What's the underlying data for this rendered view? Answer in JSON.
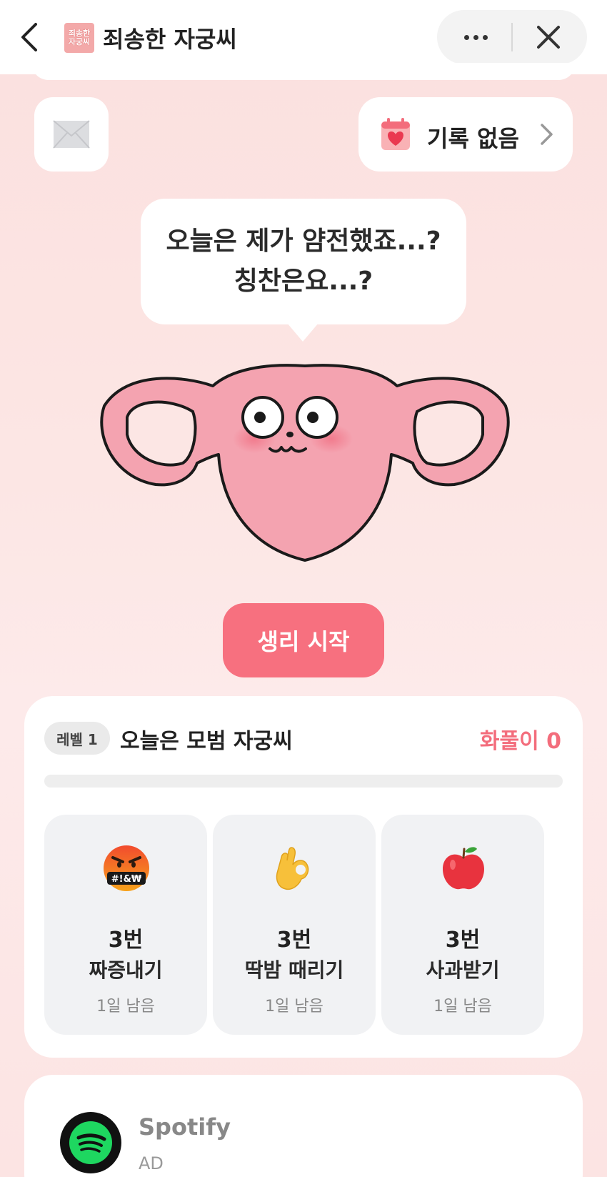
{
  "header": {
    "title": "죄송한 자궁씨",
    "app_icon_line1": "죄송한",
    "app_icon_line2": "자궁씨"
  },
  "top_bar": {
    "record_label": "기록 없음"
  },
  "speech": {
    "line1": "오늘은 제가 얌전했죠...?",
    "line2": "칭찬은요...?"
  },
  "start_button": "생리 시작",
  "level": {
    "badge": "레벨 1",
    "title": "오늘은 모범 자궁씨",
    "anger": "화풀이 0",
    "progress": 0
  },
  "actions": [
    {
      "icon": "angry-swearing-face-icon",
      "count": "3번",
      "label": "짜증내기",
      "remaining": "1일 남음"
    },
    {
      "icon": "ok-hand-icon",
      "count": "3번",
      "label": "딱밤 때리기",
      "remaining": "1일 남음"
    },
    {
      "icon": "red-apple-icon",
      "count": "3번",
      "label": "사과받기",
      "remaining": "1일 남음"
    }
  ],
  "ad": {
    "name": "Spotify",
    "tag": "AD"
  },
  "colors": {
    "accent": "#f7707f",
    "anger_text": "#f36d7c",
    "background": "#fbe0df"
  }
}
